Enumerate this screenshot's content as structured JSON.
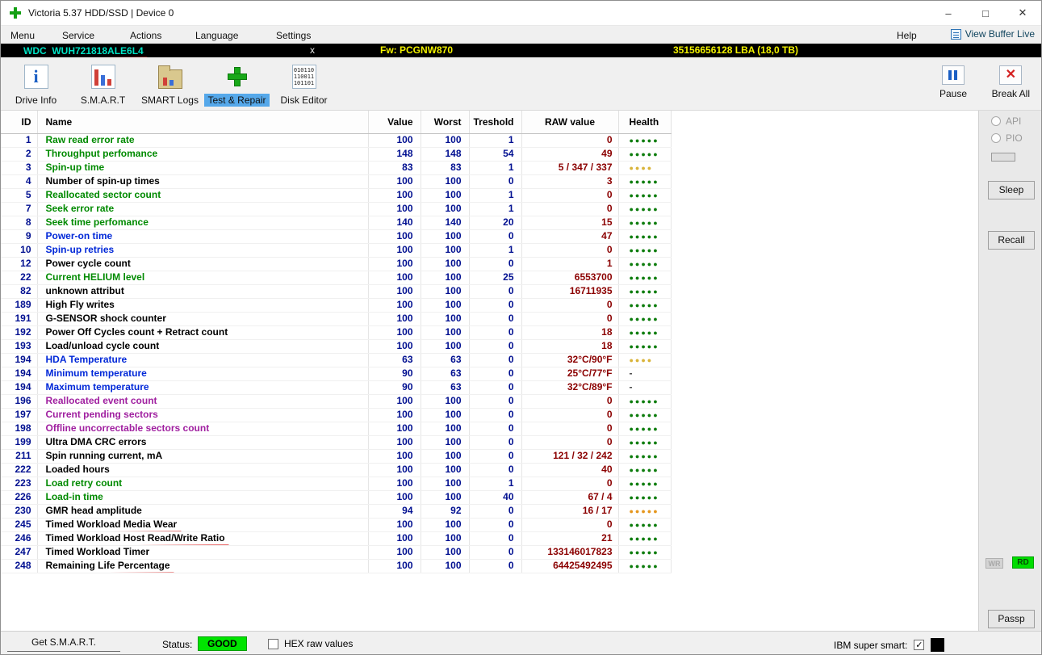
{
  "window": {
    "title": "Victoria 5.37 HDD/SSD | Device 0"
  },
  "menu": {
    "items": [
      "Menu",
      "Service",
      "Actions",
      "Language",
      "Settings"
    ],
    "help": "Help",
    "view_buffer": "View Buffer Live"
  },
  "device_bar": {
    "model": "WDC  WUH721818ALE6L4",
    "close": "x",
    "firmware": "Fw: PCGNW870",
    "capacity": "35156656128 LBA (18,0 TB)"
  },
  "toolbar": {
    "buttons": [
      {
        "label": "Drive Info"
      },
      {
        "label": "S.M.A.R.T"
      },
      {
        "label": "SMART Logs"
      },
      {
        "label": "Test & Repair",
        "active": true
      },
      {
        "label": "Disk Editor"
      }
    ],
    "pause": "Pause",
    "break_all": "Break All"
  },
  "table": {
    "headers": [
      "ID",
      "Name",
      "Value",
      "Worst",
      "Treshold",
      "RAW value",
      "Health"
    ],
    "health_colors": {
      "g": "#0e7d0e",
      "y": "#d9b43a",
      "o": "#e5971f"
    },
    "rows": [
      {
        "id": "1",
        "name": "Raw read error rate",
        "v": "100",
        "w": "100",
        "t": "1",
        "raw": "0",
        "c": "g",
        "h": "g5"
      },
      {
        "id": "2",
        "name": "Throughput perfomance",
        "v": "148",
        "w": "148",
        "t": "54",
        "raw": "49",
        "c": "g",
        "h": "g5"
      },
      {
        "id": "3",
        "name": "Spin-up time",
        "v": "83",
        "w": "83",
        "t": "1",
        "raw": "5 / 347 / 337",
        "c": "g",
        "h": "y4"
      },
      {
        "id": "4",
        "name": "Number of spin-up times",
        "v": "100",
        "w": "100",
        "t": "0",
        "raw": "3",
        "c": "k",
        "h": "g5"
      },
      {
        "id": "5",
        "name": "Reallocated sector count",
        "v": "100",
        "w": "100",
        "t": "1",
        "raw": "0",
        "c": "g",
        "h": "g5"
      },
      {
        "id": "7",
        "name": "Seek error rate",
        "v": "100",
        "w": "100",
        "t": "1",
        "raw": "0",
        "c": "g",
        "h": "g5"
      },
      {
        "id": "8",
        "name": "Seek time perfomance",
        "v": "140",
        "w": "140",
        "t": "20",
        "raw": "15",
        "c": "g",
        "h": "g5"
      },
      {
        "id": "9",
        "name": "Power-on time",
        "v": "100",
        "w": "100",
        "t": "0",
        "raw": "47",
        "c": "b",
        "h": "g5"
      },
      {
        "id": "10",
        "name": "Spin-up retries",
        "v": "100",
        "w": "100",
        "t": "1",
        "raw": "0",
        "c": "b",
        "h": "g5"
      },
      {
        "id": "12",
        "name": "Power cycle count",
        "v": "100",
        "w": "100",
        "t": "0",
        "raw": "1",
        "c": "k",
        "h": "g5"
      },
      {
        "id": "22",
        "name": "Current HELIUM level",
        "v": "100",
        "w": "100",
        "t": "25",
        "raw": "6553700",
        "c": "g",
        "h": "g5",
        "u": "raw"
      },
      {
        "id": "82",
        "name": "unknown attribut",
        "v": "100",
        "w": "100",
        "t": "0",
        "raw": "16711935",
        "c": "k",
        "h": "g5",
        "u": "id"
      },
      {
        "id": "189",
        "name": "High Fly writes",
        "v": "100",
        "w": "100",
        "t": "0",
        "raw": "0",
        "c": "k",
        "h": "g5"
      },
      {
        "id": "191",
        "name": "G-SENSOR shock counter",
        "v": "100",
        "w": "100",
        "t": "0",
        "raw": "0",
        "c": "k",
        "h": "g5"
      },
      {
        "id": "192",
        "name": "Power Off Cycles count + Retract count",
        "v": "100",
        "w": "100",
        "t": "0",
        "raw": "18",
        "c": "k",
        "h": "g5"
      },
      {
        "id": "193",
        "name": "Load/unload cycle count",
        "v": "100",
        "w": "100",
        "t": "0",
        "raw": "18",
        "c": "k",
        "h": "g5"
      },
      {
        "id": "194",
        "name": "HDA Temperature",
        "v": "63",
        "w": "63",
        "t": "0",
        "raw": "32°C/90°F",
        "c": "b",
        "h": "y4"
      },
      {
        "id": "194",
        "name": "Minimum temperature",
        "v": "90",
        "w": "63",
        "t": "0",
        "raw": "25°C/77°F",
        "c": "b",
        "h": "-"
      },
      {
        "id": "194",
        "name": "Maximum temperature",
        "v": "90",
        "w": "63",
        "t": "0",
        "raw": "32°C/89°F",
        "c": "b",
        "h": "-"
      },
      {
        "id": "196",
        "name": "Reallocated event count",
        "v": "100",
        "w": "100",
        "t": "0",
        "raw": "0",
        "c": "p",
        "h": "g5"
      },
      {
        "id": "197",
        "name": "Current pending sectors",
        "v": "100",
        "w": "100",
        "t": "0",
        "raw": "0",
        "c": "p",
        "h": "g5"
      },
      {
        "id": "198",
        "name": "Offline uncorrectable sectors count",
        "v": "100",
        "w": "100",
        "t": "0",
        "raw": "0",
        "c": "p",
        "h": "g5"
      },
      {
        "id": "199",
        "name": "Ultra DMA CRC errors",
        "v": "100",
        "w": "100",
        "t": "0",
        "raw": "0",
        "c": "k",
        "h": "g5"
      },
      {
        "id": "211",
        "name": "Spin running current, mA",
        "v": "100",
        "w": "100",
        "t": "0",
        "raw": "121 / 32 / 242",
        "c": "k",
        "h": "g5"
      },
      {
        "id": "222",
        "name": "Loaded hours",
        "v": "100",
        "w": "100",
        "t": "0",
        "raw": "40",
        "c": "k",
        "h": "g5"
      },
      {
        "id": "223",
        "name": "Load retry count",
        "v": "100",
        "w": "100",
        "t": "1",
        "raw": "0",
        "c": "g",
        "h": "g5"
      },
      {
        "id": "226",
        "name": "Load-in time",
        "v": "100",
        "w": "100",
        "t": "40",
        "raw": "67 / 4",
        "c": "g",
        "h": "g5"
      },
      {
        "id": "230",
        "name": "GMR head amplitude",
        "v": "94",
        "w": "92",
        "t": "0",
        "raw": "16 / 17",
        "c": "k",
        "h": "o5"
      },
      {
        "id": "245",
        "name": "Timed Workload Media Wear",
        "v": "100",
        "w": "100",
        "t": "0",
        "raw": "0",
        "c": "k",
        "h": "g5",
        "u": "name"
      },
      {
        "id": "246",
        "name": "Timed Workload Host Read/Write Ratio",
        "v": "100",
        "w": "100",
        "t": "0",
        "raw": "21",
        "c": "k",
        "h": "g5",
        "u": "name"
      },
      {
        "id": "247",
        "name": "Timed Workload Timer",
        "v": "100",
        "w": "100",
        "t": "0",
        "raw": "133146017823",
        "c": "k",
        "h": "g5",
        "u": "name"
      },
      {
        "id": "248",
        "name": "Remaining Life Percentage",
        "v": "100",
        "w": "100",
        "t": "0",
        "raw": "64425492495",
        "c": "k",
        "h": "g5",
        "u": "name"
      }
    ]
  },
  "right_panel": {
    "api": "API",
    "pio": "PIO",
    "sleep": "Sleep",
    "recall": "Recall",
    "wr": "WR",
    "rd": "RD",
    "passp": "Passp"
  },
  "status_bar": {
    "get_smart": "Get S.M.A.R.T.",
    "status_label": "Status:",
    "status_value": "GOOD",
    "hex_label": "HEX raw values",
    "ibm_label": "IBM super smart:"
  }
}
